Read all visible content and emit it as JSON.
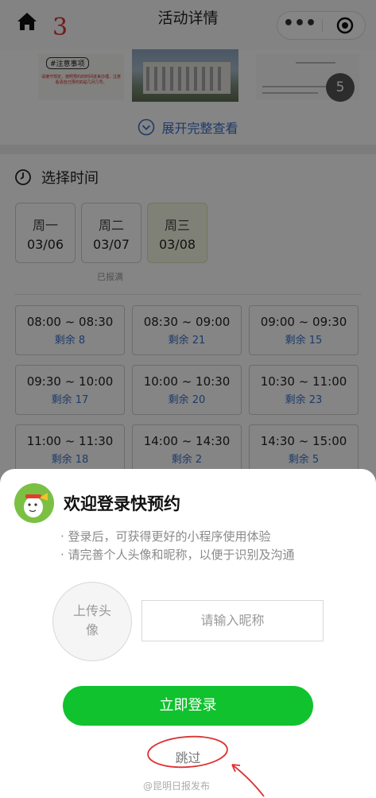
{
  "header": {
    "title": "活动详情",
    "annotation_number": "3",
    "more_icon": "more-dots-icon",
    "close_icon": "target-close-icon"
  },
  "gallery": {
    "thumb1_tag": "#注意事项",
    "thumb1_text": "请遵守规定，按照预约的时间进来办理，注意看清自己预约的是几月几号。",
    "count_badge": "5"
  },
  "expand_label": "展开完整查看",
  "time_section": {
    "title": "选择时间"
  },
  "days": [
    {
      "weekday": "周一",
      "date": "03/06"
    },
    {
      "weekday": "周二",
      "date": "03/07"
    },
    {
      "weekday": "周三",
      "date": "03/08"
    }
  ],
  "day_full_note": "已报满",
  "slots": [
    {
      "time": "08:00 ~ 08:30",
      "remain": "剩余 8"
    },
    {
      "time": "08:30 ~ 09:00",
      "remain": "剩余 21"
    },
    {
      "time": "09:00 ~ 09:30",
      "remain": "剩余 15"
    },
    {
      "time": "09:30 ~ 10:00",
      "remain": "剩余 17"
    },
    {
      "time": "10:00 ~ 10:30",
      "remain": "剩余 20"
    },
    {
      "time": "10:30 ~ 11:00",
      "remain": "剩余 23"
    },
    {
      "time": "11:00 ~ 11:30",
      "remain": "剩余 18"
    },
    {
      "time": "14:00 ~ 14:30",
      "remain": "剩余 2"
    },
    {
      "time": "14:30 ~ 15:00",
      "remain": "剩余 5"
    }
  ],
  "login": {
    "title": "欢迎登录快预约",
    "tip1": "· 登录后，可获得更好的小程序使用体验",
    "tip2": "· 请完善个人头像和昵称，以便于识别及沟通",
    "upload_label": "上传头像",
    "nickname_placeholder": "请输入昵称",
    "login_button": "立即登录",
    "skip_label": "跳过"
  },
  "colors": {
    "accent": "#3a72c8",
    "primary_button": "#10c22e",
    "annotation": "#d33"
  },
  "watermark": "@昆明日报发布"
}
